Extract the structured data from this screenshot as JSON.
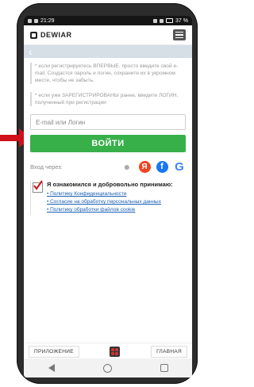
{
  "statusbar": {
    "time": "21:29",
    "battery": "37 %"
  },
  "header": {
    "logo_text": "DEWIAR"
  },
  "info": {
    "first": "* если регистрируетесь ВПЕРВЫЕ, просто введите свой e-mail. Создастся пароль и логин, сохраните их в укромном месте, чтобы не забыть.",
    "second": "* если уже ЗАРЕГИСТРИРОВАНЫ ранее, введите ЛОГИН, полученный при регистрации"
  },
  "form": {
    "email_placeholder": "E-mail или Логин",
    "submit_label": "ВОЙТИ"
  },
  "social": {
    "label": "Вход через:",
    "icons": [
      "apple-icon",
      "yandex-icon",
      "facebook-icon",
      "google-icon"
    ]
  },
  "consent": {
    "title": "Я ознакомился и добровольно принимаю:",
    "links": [
      "• Политику Конфиденциальности",
      "• Согласие на обработку персональных данных",
      "• Политику обработки файлов cookie"
    ]
  },
  "bottom_tabs": {
    "left": "ПРИЛОЖЕНИЕ",
    "right": "ГЛАВНАЯ"
  },
  "colors": {
    "accent": "#37b04a",
    "arrow": "#d0101a",
    "link": "#1a5fb4"
  }
}
